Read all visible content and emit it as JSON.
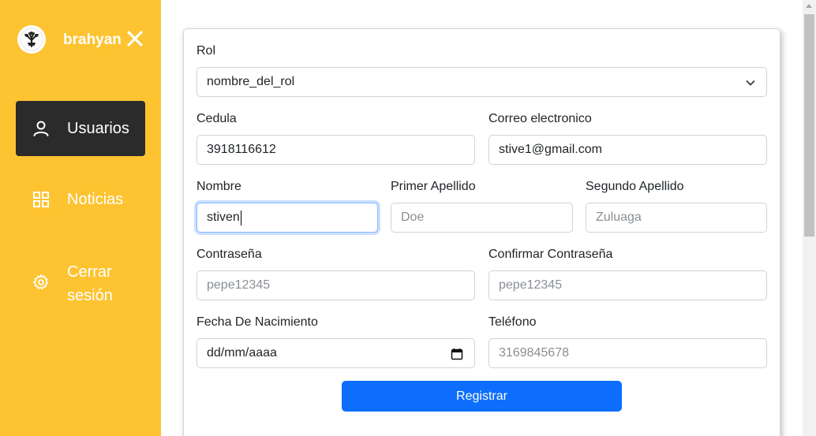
{
  "sidebar": {
    "user_name": "brahyan",
    "items": [
      {
        "label": "Usuarios",
        "icon": "user-icon",
        "active": true
      },
      {
        "label": "Noticias",
        "icon": "grid-icon"
      },
      {
        "label": "Cerrar sesión",
        "icon": "gear-icon"
      }
    ]
  },
  "form": {
    "rol": {
      "label": "Rol",
      "value": "nombre_del_rol"
    },
    "cedula": {
      "label": "Cedula",
      "value": "3918116612"
    },
    "correo": {
      "label": "Correo electronico",
      "value": "stive1@gmail.com"
    },
    "nombre": {
      "label": "Nombre",
      "value": "stiven"
    },
    "primer_apellido": {
      "label": "Primer Apellido",
      "placeholder": "Doe"
    },
    "segundo_apellido": {
      "label": "Segundo Apellido",
      "placeholder": "Zuluaga"
    },
    "contrasena": {
      "label": "Contraseña",
      "placeholder": "pepe12345"
    },
    "confirmar": {
      "label": "Confirmar Contraseña",
      "placeholder": "pepe12345"
    },
    "fecha": {
      "label": "Fecha De Nacimiento",
      "value": "dd/mm/aaaa"
    },
    "telefono": {
      "label": "Teléfono",
      "placeholder": "3169845678"
    },
    "submit_label": "Registrar"
  },
  "colors": {
    "sidebar": "#fdc331",
    "active_item": "#2b2b2b",
    "primary": "#0d6efd"
  }
}
